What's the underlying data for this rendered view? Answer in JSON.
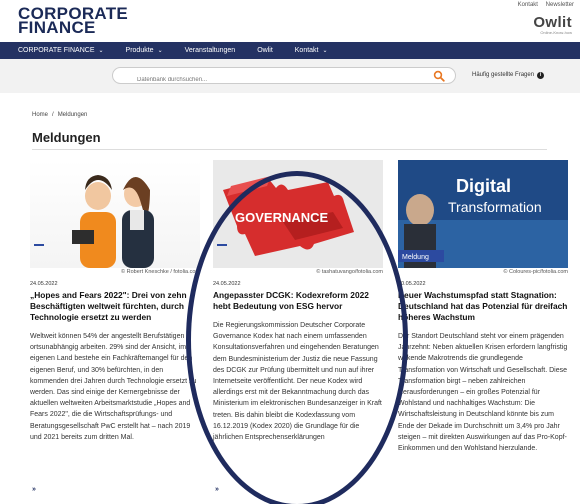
{
  "header": {
    "logo_line1": "CORPORATE",
    "logo_line2": "FINANCE",
    "top_links": [
      "Kontakt",
      "Newsletter"
    ],
    "partner_brand": "Owlit",
    "partner_tagline": "Online-Know-how"
  },
  "nav": {
    "items": [
      {
        "label": "CORPORATE FINANCE",
        "has_dropdown": true
      },
      {
        "label": "Produkte",
        "has_dropdown": true
      },
      {
        "label": "Veranstaltungen",
        "has_dropdown": false
      },
      {
        "label": "Owlit",
        "has_dropdown": false
      },
      {
        "label": "Kontakt",
        "has_dropdown": true
      }
    ]
  },
  "search": {
    "placeholder": "Datenbank durchsuchen...",
    "faq_label": "Häufig gestellte Fragen",
    "faq_icon": "info-icon",
    "icon": "search-icon",
    "accent": "#e87722"
  },
  "breadcrumb": {
    "home": "Home",
    "separator": "/",
    "current": "Meldungen"
  },
  "page": {
    "title": "Meldungen"
  },
  "colors": {
    "nav_bg": "#243263",
    "brand_navy": "#1b2a57",
    "overlay": "#1f2b5e"
  },
  "cards": [
    {
      "credit": "© Robert Kneschke / fotolia.com",
      "date": "24.05.2022",
      "title": "„Hopes and Fears 2022\": Drei von zehn Beschäftigten weltweit fürchten, durch Technologie ersetzt zu werden",
      "body": "Weltweit können 54% der angestellt Berufstätigen ortsunabhängig arbeiten. 29% sind der Ansicht, im eigenen Land bestehe ein Fachkräftemangel für den eigenen Beruf, und 30% befürchten, in den kommenden drei Jahren durch Technologie ersetzt zu werden. Das sind einige der Kernergebnisse der aktuellen weltweiten Arbeitsmarktstudie „Hopes and Fears 2022\", die die Wirtschaftsprüfungs- und Beratungsgesellschaft PwC erstellt hat – nach 2019 und 2021 bereits zum dritten Mal.",
      "more": "»"
    },
    {
      "credit": "© tashatuvango/fotolia.com",
      "date": "24.05.2022",
      "image_label": "GOVERNANCE",
      "title": "Angepasster DCGK: Kodexreform 2022 hebt Bedeutung von ESG hervor",
      "body": "Die Regierungskommission Deutscher Corporate Governance Kodex hat nach einem umfassenden Konsultationsverfahren und eingehenden Beratungen dem Bundesministerium der Justiz die neue Fassung des DCGK zur Prüfung übermittelt und nun auf ihrer Internetseite veröffentlicht. Der neue Kodex wird allerdings erst mit der Bekanntmachung durch das Ministerium im elektronischen Bundesanzeiger in Kraft treten. Bis dahin bleibt die Kodexfassung vom 16.12.2019 (Kodex 2020) die Grundlage für die jährlichen Entsprechenserklärungen",
      "more": "»"
    },
    {
      "credit": "© Coloures-pic/fotolia.com",
      "date": "20.05.2022",
      "image_label_1": "Digital",
      "image_label_2": "Transformation",
      "tag": "Meldung",
      "title": "Neuer Wachstumspfad statt Stagnation: Deutschland hat das Potenzial für dreifach höheres Wachstum",
      "body": "Der Standort Deutschland steht vor einem prägenden Jahrzehnt: Neben aktuellen Krisen erfordern langfristig wirkende Makrotrends die grundlegende Transformation von Wirtschaft und Gesellschaft. Diese Transformation birgt – neben zahlreichen Herausforderungen – ein großes Potenzial für Wohlstand und nachhaltiges Wachstum: Die Wirtschaftsleistung in Deutschland könnte bis zum Ende der Dekade im Durchschnitt um 3,4% pro Jahr steigen – mit direkten Auswirkungen auf das Pro-Kopf-Einkommen und den Wohlstand hierzulande.",
      "more": "»"
    }
  ]
}
